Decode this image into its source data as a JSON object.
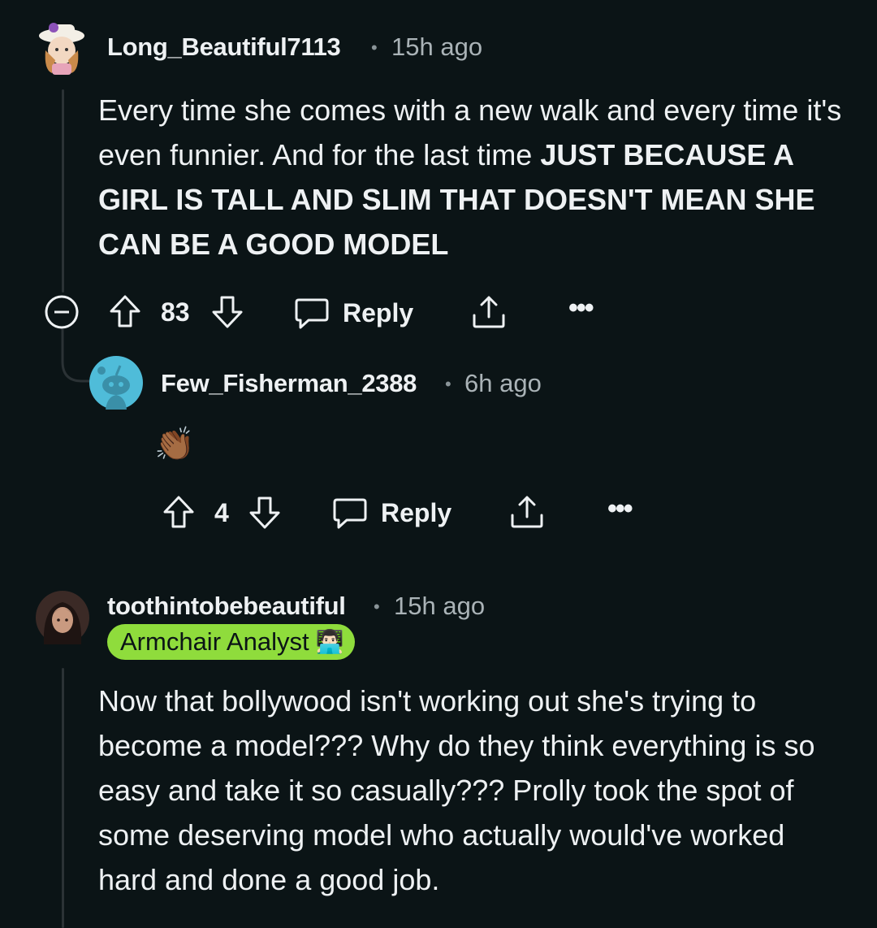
{
  "comment1": {
    "username": "Long_Beautiful7113",
    "time": "15h ago",
    "body_plain": "Every time she comes with a new walk and every time it's even funnier. And for the last time ",
    "body_bold": "JUST BECAUSE A GIRL IS TALL AND SLIM THAT DOESN'T MEAN SHE CAN BE A GOOD MODEL",
    "votes": "83",
    "reply_label": "Reply"
  },
  "comment2": {
    "username": "Few_Fisherman_2388",
    "time": "6h ago",
    "body_emoji": "👏🏾",
    "votes": "4",
    "reply_label": "Reply"
  },
  "comment3": {
    "username": "toothintobebeautiful",
    "time": "15h ago",
    "flair": "Armchair Analyst",
    "flair_emoji": "👨🏻‍💻",
    "body": "Now that bollywood isn't working out she's trying to become a model??? Why do they think everything is so easy and take it so casually??? Prolly took the spot of some deserving model who actually would've worked hard and done a good job."
  },
  "colors": {
    "background": "#0b1416",
    "text": "#eef1f3",
    "muted": "#aab3b7",
    "flair_bg": "#8fdc3c",
    "avatar_blue": "#4fbcd9"
  },
  "icons": [
    "collapse-icon",
    "upvote-icon",
    "downvote-icon",
    "reply-icon",
    "share-icon",
    "more-icon"
  ]
}
